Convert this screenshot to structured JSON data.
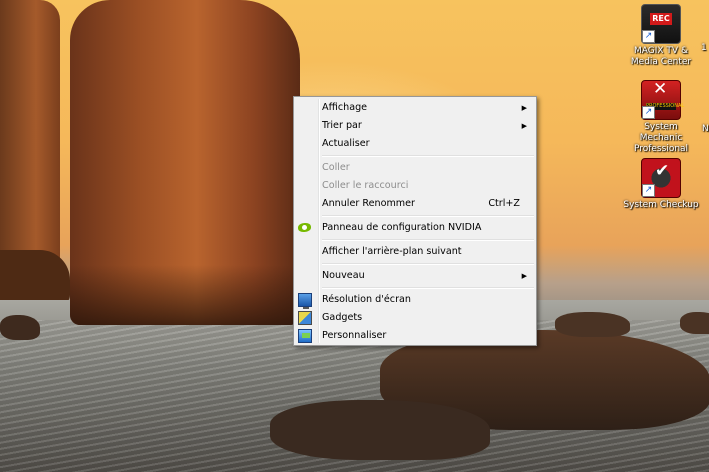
{
  "desktop": {
    "icons": [
      {
        "label_line1": "MAGIX TV &",
        "label_line2": "Media Center",
        "icon": "magix-tv-icon",
        "badge": "REC"
      },
      {
        "label_line1": "System Mechanic",
        "label_line2": "Professional",
        "icon": "system-mechanic-icon",
        "badge": "PROFESSIONAL"
      },
      {
        "label_line1": "System Checkup",
        "label_line2": "",
        "icon": "system-checkup-icon"
      }
    ],
    "edge_labels": [
      "1",
      "N"
    ]
  },
  "context_menu": {
    "items": [
      {
        "label": "Affichage",
        "submenu": true
      },
      {
        "label": "Trier par",
        "submenu": true
      },
      {
        "label": "Actualiser"
      },
      {
        "label": "Coller",
        "disabled": true
      },
      {
        "label": "Coller le raccourci",
        "disabled": true
      },
      {
        "label": "Annuler Renommer",
        "shortcut": "Ctrl+Z"
      },
      {
        "label": "Panneau de configuration NVIDIA",
        "icon": "nvidia-icon"
      },
      {
        "label": "Afficher l'arrière-plan suivant"
      },
      {
        "label": "Nouveau",
        "submenu": true
      },
      {
        "label": "Résolution d'écran",
        "icon": "screen-resolution-icon"
      },
      {
        "label": "Gadgets",
        "icon": "gadgets-icon"
      },
      {
        "label": "Personnaliser",
        "icon": "personalize-icon"
      }
    ],
    "submenu_arrow": "▶"
  }
}
